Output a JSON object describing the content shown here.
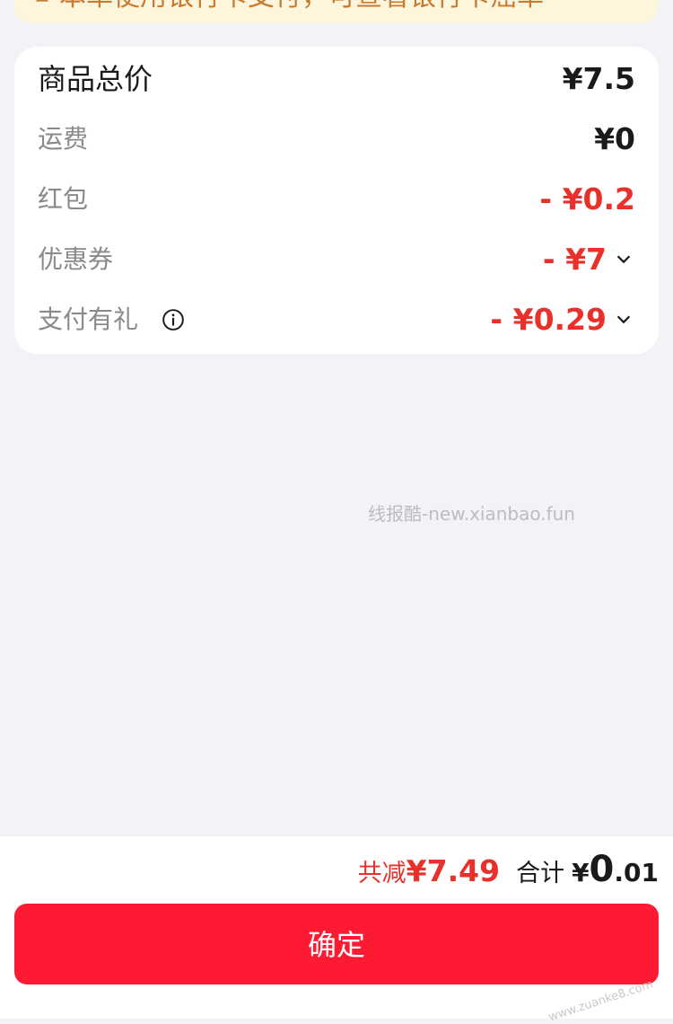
{
  "notice": {
    "text": "本单使用银行卡支付，可查看银行卡癌单"
  },
  "summary_card": {
    "rows": [
      {
        "label": "商品总价",
        "value": "¥7.5"
      },
      {
        "label": "运费",
        "value": "¥0"
      },
      {
        "label": "红包",
        "value": "- ¥0.2"
      },
      {
        "label": "优惠券",
        "value": "- ¥7"
      },
      {
        "label": "支付有礼",
        "value": "- ¥0.29"
      }
    ]
  },
  "watermark": "线报酷-new.xianbao.fun",
  "footer": {
    "saved_label": "共减",
    "saved_value": "¥7.49",
    "total_label": "合计",
    "total_currency": "¥",
    "total_int": "0",
    "total_dec": ".01",
    "confirm_label": "确定",
    "corner_mark": "www.zuanke8.com"
  },
  "colors": {
    "accent_red": "#fd1a32",
    "discount_red": "#e8312b",
    "notice_bg": "#fdf6dc"
  },
  "icons": [
    "bell-icon",
    "chevron-right-icon",
    "chevron-down-icon",
    "info-icon"
  ]
}
